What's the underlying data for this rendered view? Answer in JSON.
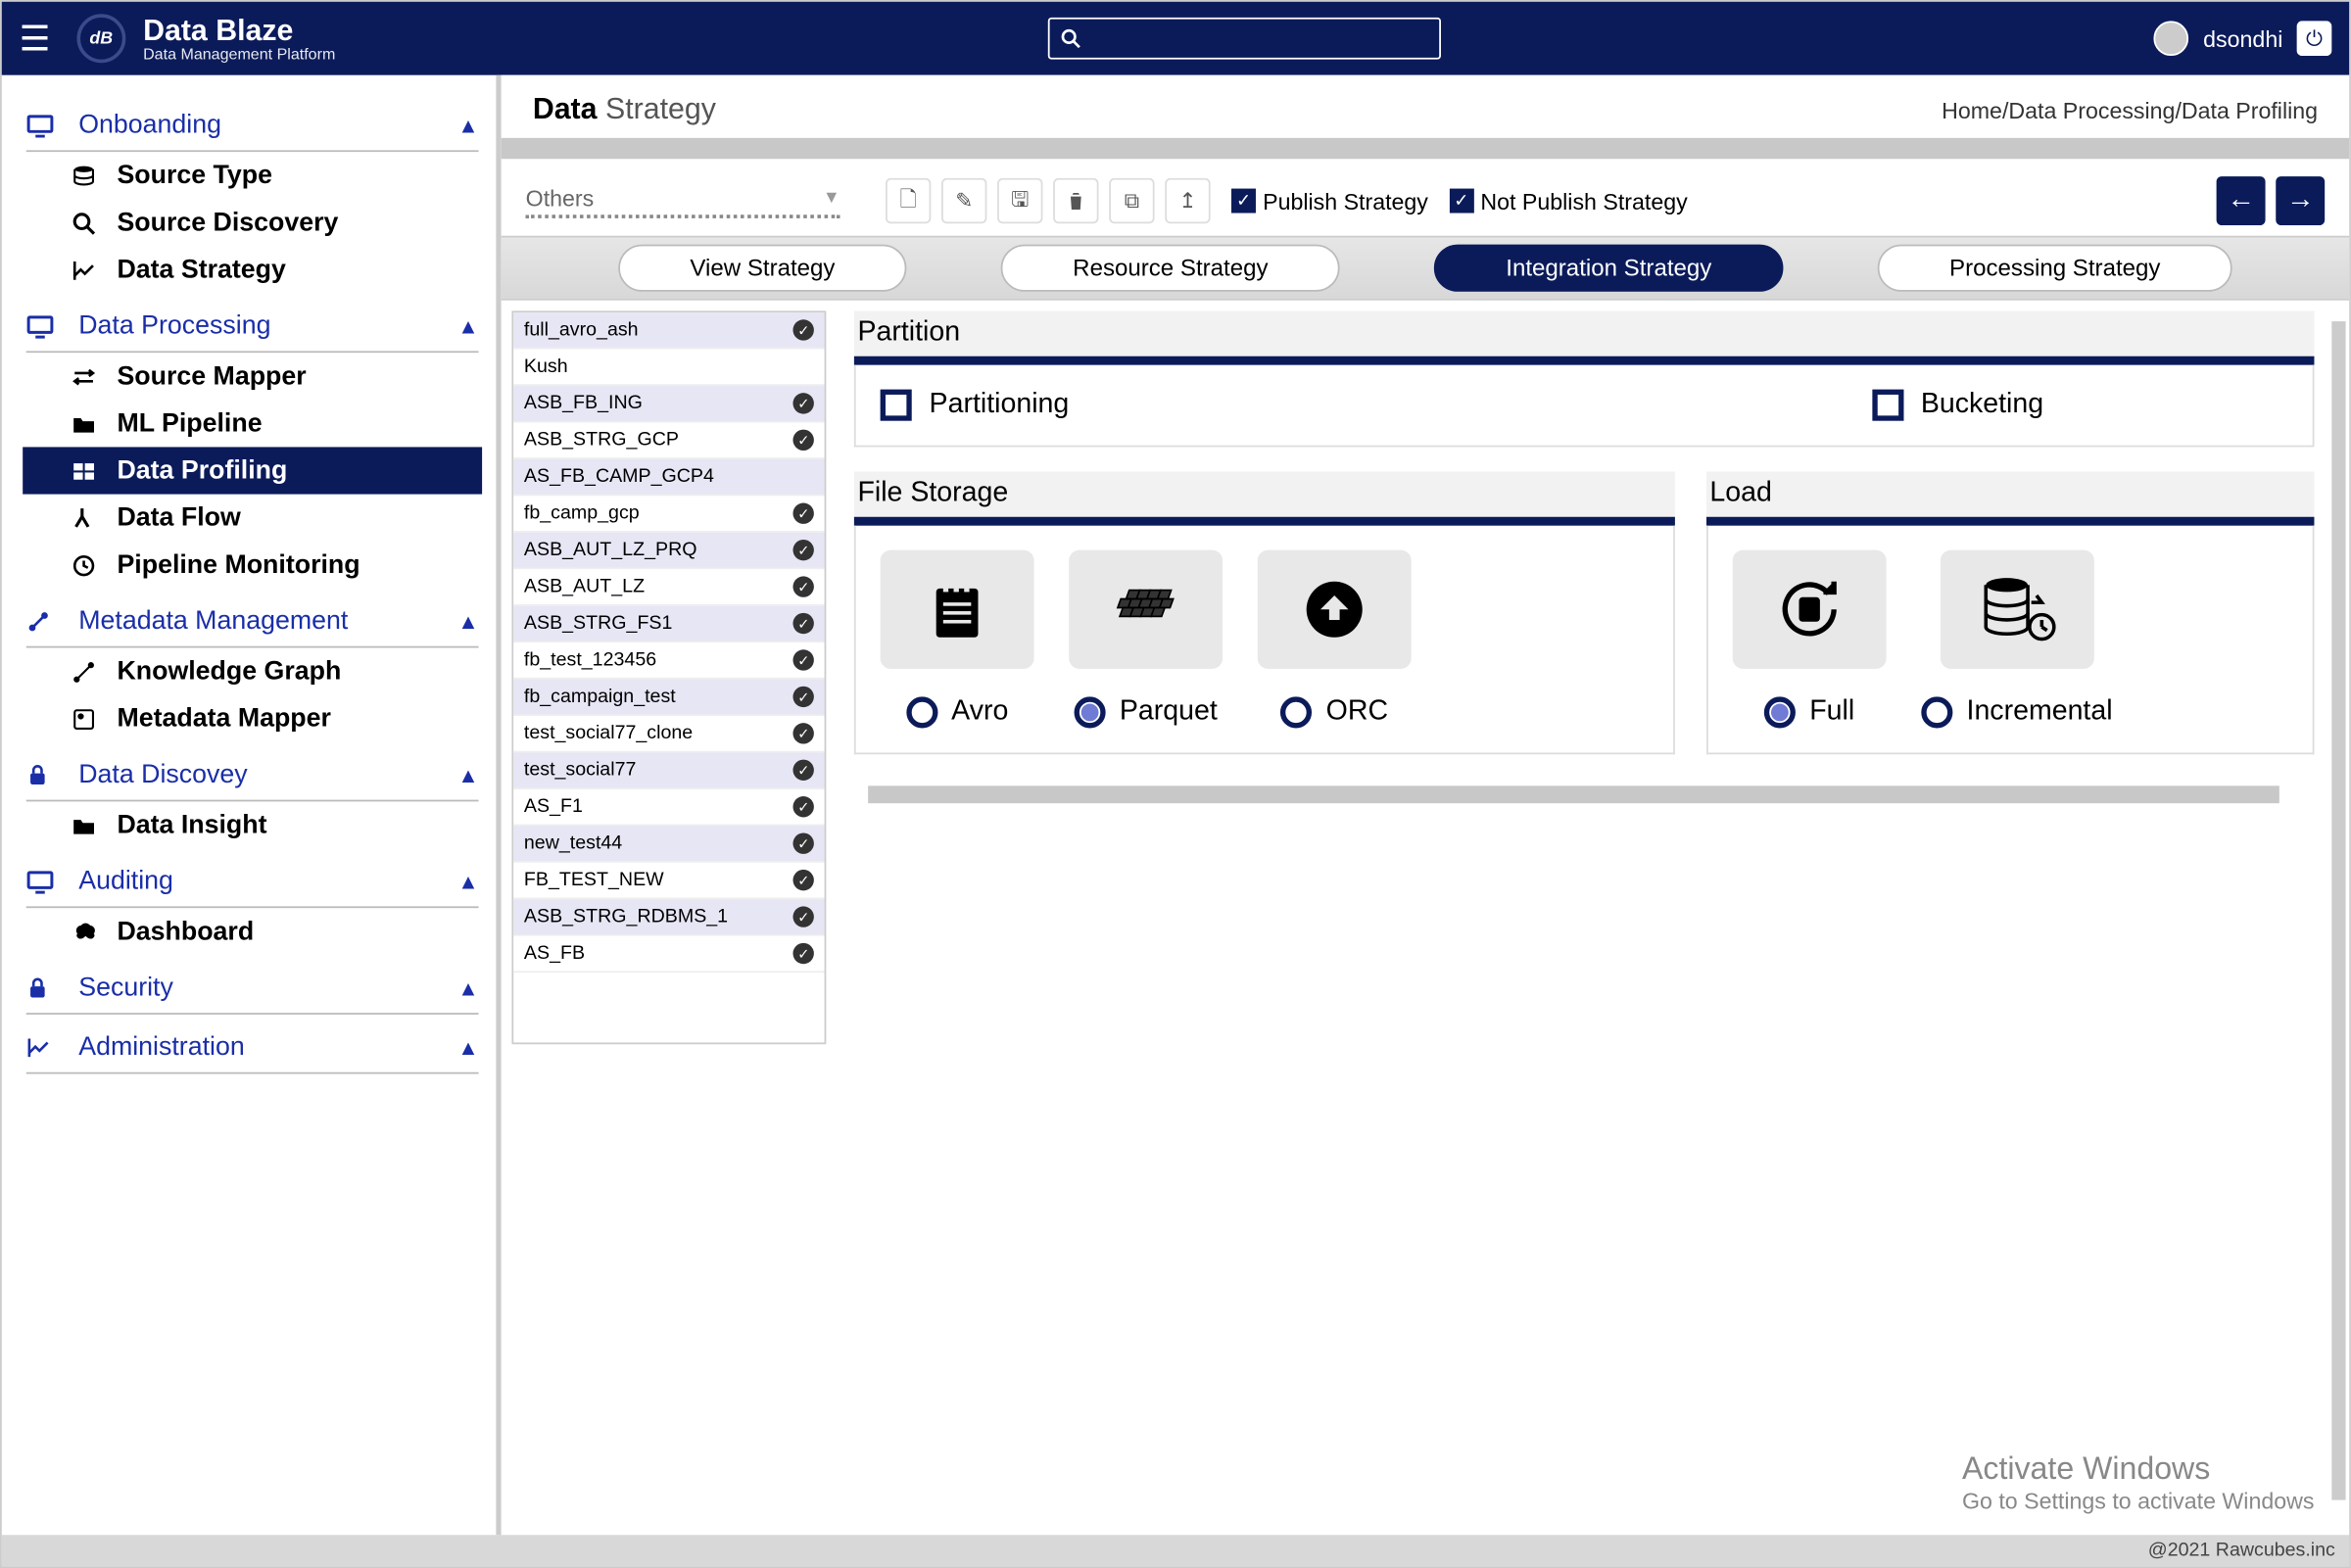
{
  "brand": {
    "title": "Data Blaze",
    "subtitle": "Data Management Platform",
    "logo_text": "dB"
  },
  "user": {
    "name": "dsondhi"
  },
  "page": {
    "title_bold": "Data",
    "title_light": "Strategy"
  },
  "breadcrumb": [
    "Home",
    "Data Processing",
    "Data Profiling"
  ],
  "sidebar": [
    {
      "label": "Onboanding",
      "icon": "monitor",
      "items": [
        {
          "label": "Source Type",
          "icon": "db"
        },
        {
          "label": "Source Discovery",
          "icon": "search"
        },
        {
          "label": "Data Strategy",
          "icon": "chart"
        }
      ]
    },
    {
      "label": "Data Processing",
      "icon": "monitor",
      "items": [
        {
          "label": "Source Mapper",
          "icon": "arrows"
        },
        {
          "label": "ML Pipeline",
          "icon": "folder"
        },
        {
          "label": "Data Profiling",
          "icon": "grid",
          "active": true
        },
        {
          "label": "Data Flow",
          "icon": "branch"
        },
        {
          "label": "Pipeline Monitoring",
          "icon": "clock"
        }
      ]
    },
    {
      "label": "Metadata Management",
      "icon": "link",
      "items": [
        {
          "label": "Knowledge Graph",
          "icon": "graph"
        },
        {
          "label": "Metadata Mapper",
          "icon": "map"
        }
      ]
    },
    {
      "label": "Data Discovey",
      "icon": "lock",
      "items": [
        {
          "label": "Data Insight",
          "icon": "folder"
        }
      ]
    },
    {
      "label": "Auditing",
      "icon": "monitor",
      "items": [
        {
          "label": "Dashboard",
          "icon": "brain"
        }
      ]
    },
    {
      "label": "Security",
      "icon": "lock",
      "items": []
    },
    {
      "label": "Administration",
      "icon": "chart",
      "items": []
    }
  ],
  "toolbar": {
    "dropdown": "Others",
    "publish": "Publish Strategy",
    "not_publish": "Not Publish Strategy"
  },
  "strategy_tabs": [
    "View Strategy",
    "Resource Strategy",
    "Integration Strategy",
    "Processing Strategy"
  ],
  "strategy_active": 2,
  "entities": [
    {
      "name": "full_avro_ash",
      "checked": true
    },
    {
      "name": "Kush",
      "checked": false
    },
    {
      "name": "ASB_FB_ING",
      "checked": true
    },
    {
      "name": "ASB_STRG_GCP",
      "checked": true
    },
    {
      "name": "AS_FB_CAMP_GCP4",
      "checked": false
    },
    {
      "name": "fb_camp_gcp",
      "checked": true
    },
    {
      "name": "ASB_AUT_LZ_PRQ",
      "checked": true
    },
    {
      "name": "ASB_AUT_LZ",
      "checked": true
    },
    {
      "name": "ASB_STRG_FS1",
      "checked": true
    },
    {
      "name": "fb_test_123456",
      "checked": true
    },
    {
      "name": "fb_campaign_test",
      "checked": true
    },
    {
      "name": "test_social77_clone",
      "checked": true
    },
    {
      "name": "test_social77",
      "checked": true
    },
    {
      "name": "AS_F1",
      "checked": true
    },
    {
      "name": "new_test44",
      "checked": true
    },
    {
      "name": "FB_TEST_NEW",
      "checked": true
    },
    {
      "name": "ASB_STRG_RDBMS_1",
      "checked": true
    },
    {
      "name": "AS_FB",
      "checked": true
    }
  ],
  "panels": {
    "partition": {
      "title": "Partition",
      "opt1": "Partitioning",
      "opt2": "Bucketing"
    },
    "file_storage": {
      "title": "File Storage",
      "options": [
        "Avro",
        "Parquet",
        "ORC"
      ],
      "selected": 1
    },
    "load": {
      "title": "Load",
      "options": [
        "Full",
        "Incremental"
      ],
      "selected": 0
    }
  },
  "footer": "@2021 Rawcubes.inc",
  "activate": {
    "line1": "Activate Windows",
    "line2": "Go to Settings to activate Windows"
  }
}
